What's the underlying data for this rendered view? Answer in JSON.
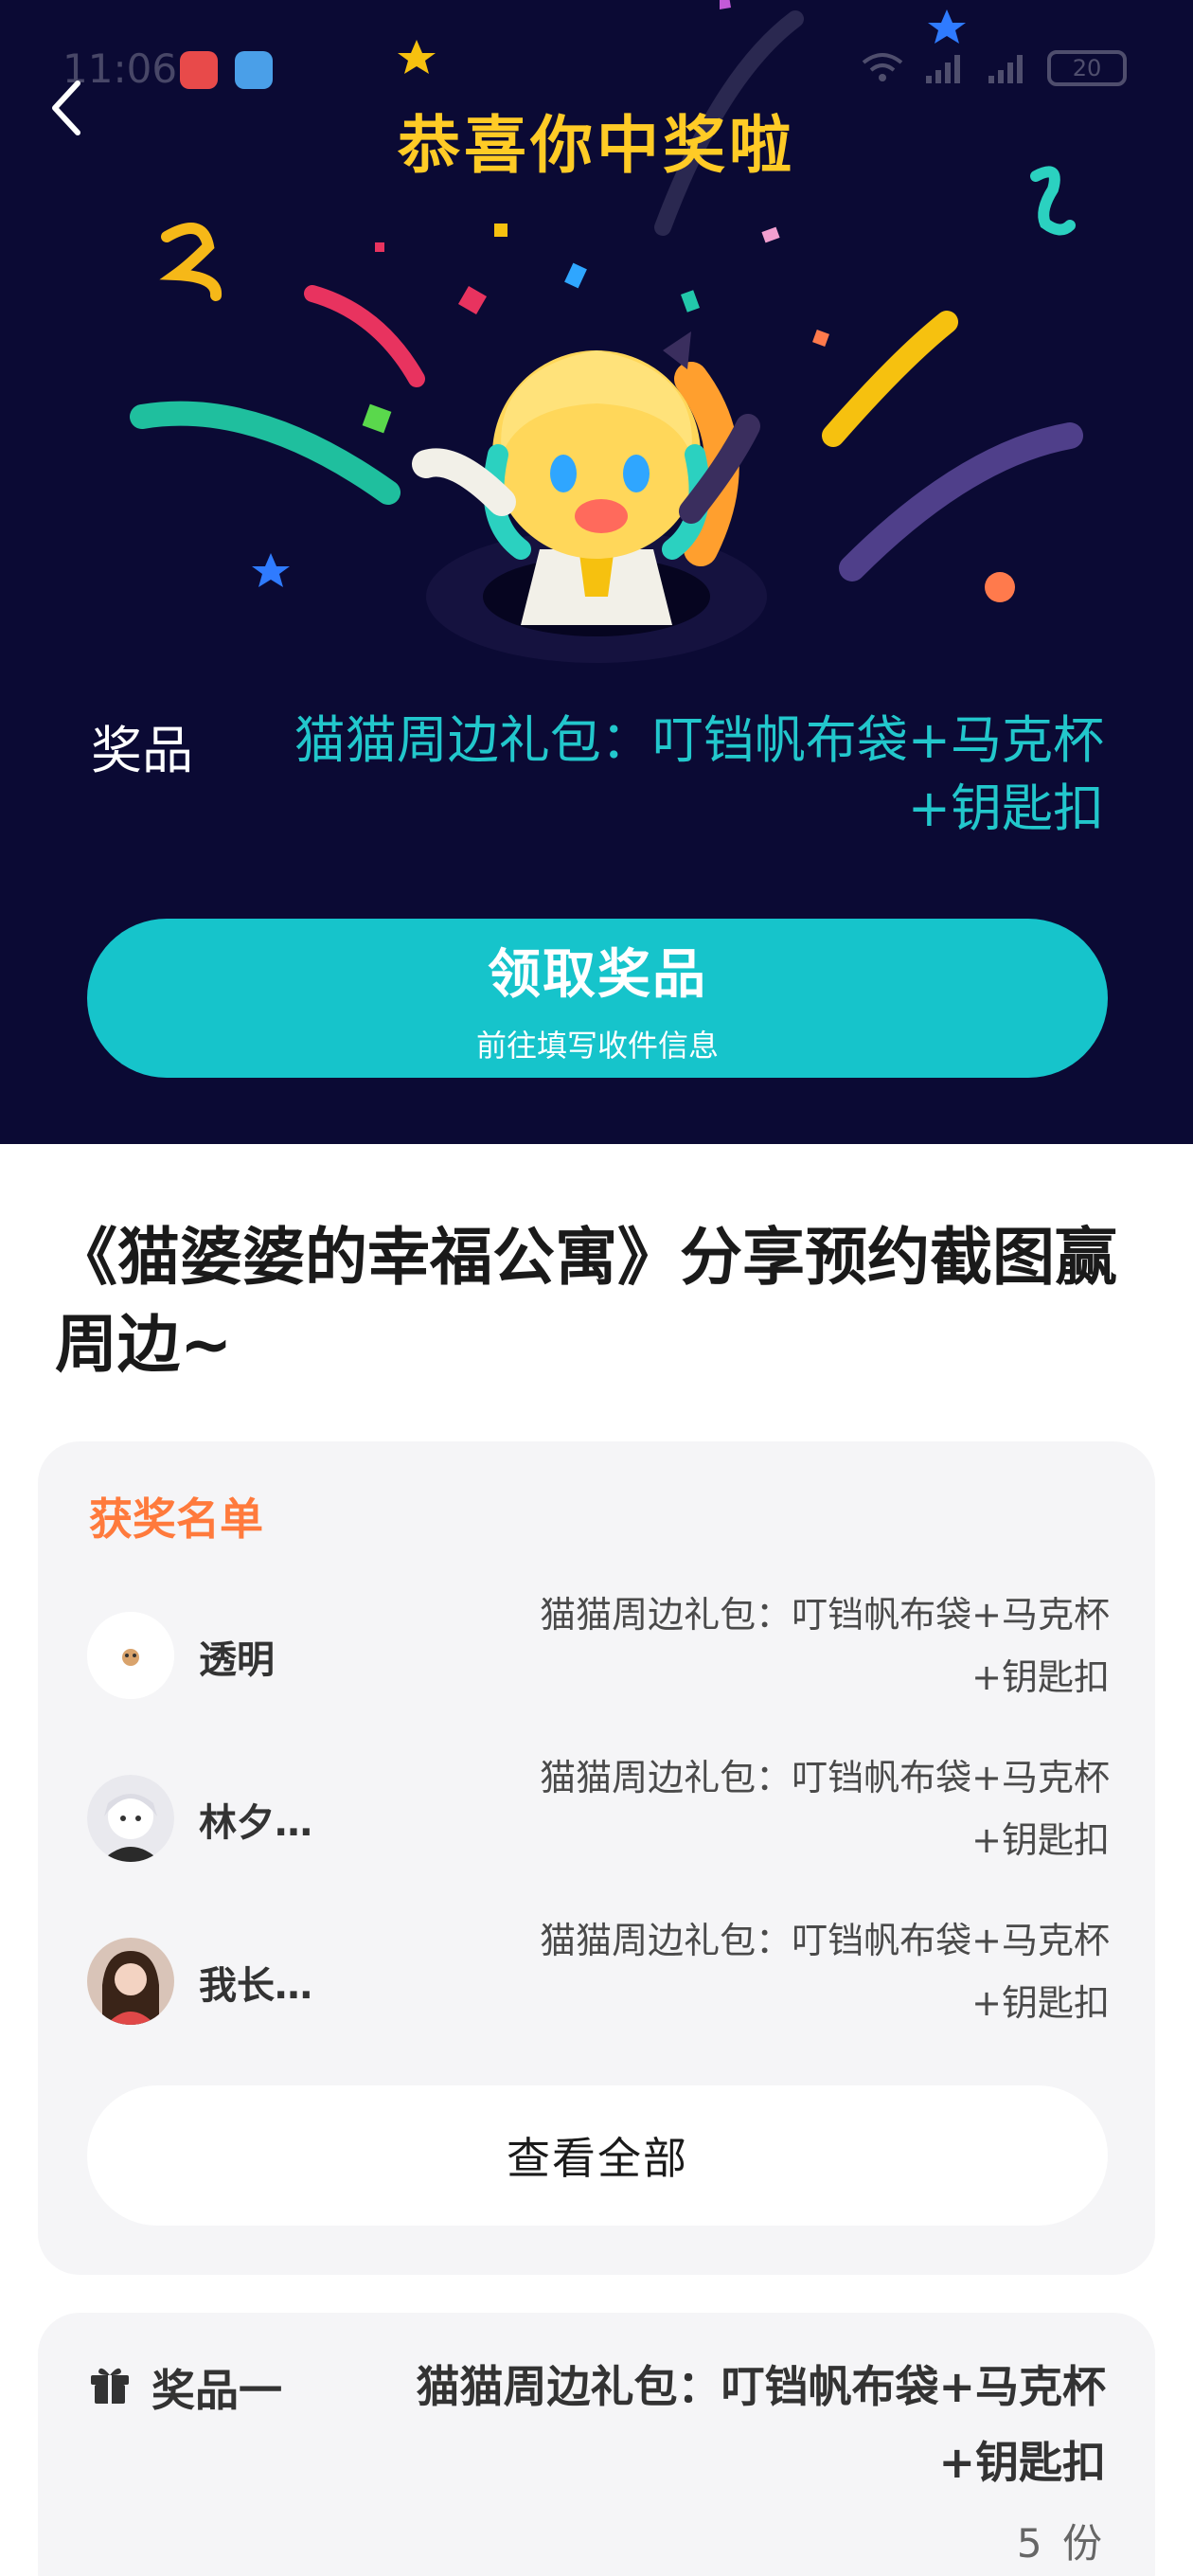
{
  "status_bar": {
    "time": "11:06",
    "battery": "20"
  },
  "hero": {
    "title": "恭喜你中奖啦",
    "prize_label": "奖品",
    "prize_name": "猫猫周边礼包：叮铛帆布袋+马克杯+钥匙扣",
    "claim_button": {
      "title": "领取奖品",
      "subtitle": "前往填写收件信息"
    }
  },
  "event": {
    "title": "《猫婆婆的幸福公寓》分享预约截图赢周边~"
  },
  "winners": {
    "heading": "获奖名单",
    "items": [
      {
        "name": "透明",
        "prize_line1": "猫猫周边礼包：叮铛帆布袋+马克杯",
        "prize_line2": "+钥匙扣"
      },
      {
        "name": "林夕…",
        "prize_line1": "猫猫周边礼包：叮铛帆布袋+马克杯",
        "prize_line2": "+钥匙扣"
      },
      {
        "name": "我长…",
        "prize_line1": "猫猫周边礼包：叮铛帆布袋+马克杯",
        "prize_line2": "+钥匙扣"
      }
    ],
    "view_all": "查看全部"
  },
  "prize_card": {
    "tier": "奖品一",
    "detail": "猫猫周边礼包：叮铛帆布袋+马克杯+钥匙扣",
    "quantity": "5 份"
  },
  "colors": {
    "hero_bg": "#0b0a34",
    "title_yellow": "#ffcb26",
    "accent_teal": "#16c4cb",
    "winners_orange": "#ff7a3c"
  },
  "icons": [
    "back-arrow-icon",
    "gift-icon",
    "signal-icon",
    "wifi-icon",
    "battery-icon"
  ]
}
